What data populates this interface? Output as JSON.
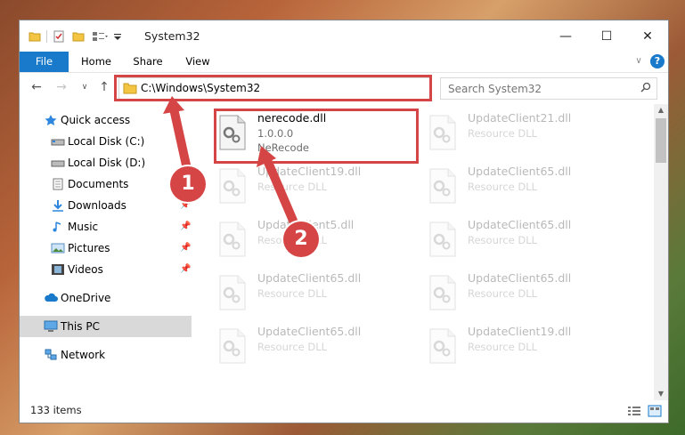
{
  "window": {
    "title": "System32",
    "minimize": "—",
    "maximize": "☐",
    "close": "✕"
  },
  "ribbon": {
    "tabs": [
      "File",
      "Home",
      "Share",
      "View"
    ],
    "collapse": "∨",
    "help": "?"
  },
  "navbar": {
    "back": "←",
    "forward": "→",
    "recent": "∨",
    "up": "↑",
    "address": "C:\\Windows\\System32",
    "address_dropdown": "∨",
    "refresh": "↻",
    "search_placeholder": "Search System32"
  },
  "navpane": {
    "items": [
      {
        "label": "Quick access"
      },
      {
        "label": "Local Disk (C:)"
      },
      {
        "label": "Local Disk (D:)"
      },
      {
        "label": "Documents"
      },
      {
        "label": "Downloads"
      },
      {
        "label": "Music"
      },
      {
        "label": "Pictures"
      },
      {
        "label": "Videos"
      },
      {
        "label": "OneDrive"
      },
      {
        "label": "This PC"
      },
      {
        "label": "Network"
      }
    ]
  },
  "files": [
    {
      "name": "nerecode.dll",
      "version": "1.0.0.0",
      "desc": "NeRecode"
    },
    {
      "name": "UpdateClient21.dll",
      "version": "",
      "desc": "Resource DLL"
    },
    {
      "name": "UpdateClient19.dll",
      "version": "",
      "desc": "Resource DLL"
    },
    {
      "name": "UpdateClient65.dll",
      "version": "",
      "desc": "Resource DLL"
    },
    {
      "name": "UpdateClient5.dll",
      "version": "",
      "desc": "Resource DLL"
    },
    {
      "name": "UpdateClient65.dll",
      "version": "",
      "desc": "Resource DLL"
    },
    {
      "name": "UpdateClient65.dll",
      "version": "",
      "desc": "Resource DLL"
    },
    {
      "name": "UpdateClient65.dll",
      "version": "",
      "desc": "Resource DLL"
    },
    {
      "name": "UpdateClient65.dll",
      "version": "",
      "desc": "Resource DLL"
    },
    {
      "name": "UpdateClient19.dll",
      "version": "",
      "desc": "Resource DLL"
    }
  ],
  "status": {
    "item_count": "133 items"
  },
  "annotations": {
    "badge1": "1",
    "badge2": "2",
    "accent_color": "#d64545"
  }
}
